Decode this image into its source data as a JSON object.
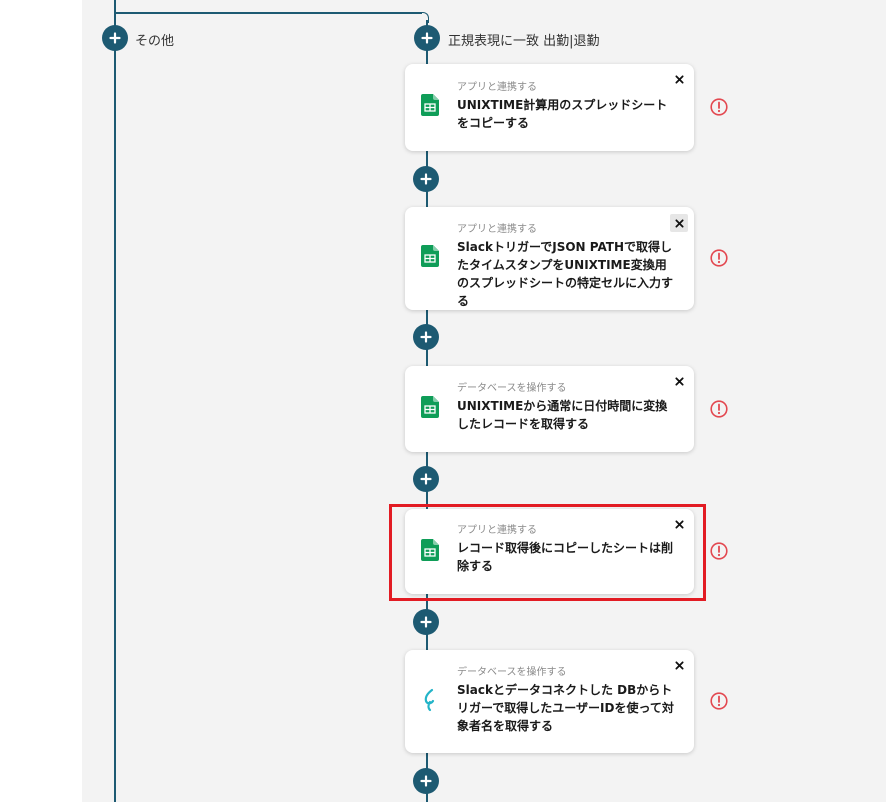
{
  "branches": {
    "other": {
      "label": "その他"
    },
    "regex": {
      "label": "正規表現に一致 出勤|退勤"
    }
  },
  "steps": [
    {
      "subtitle": "アプリと連携する",
      "title": "UNIXTIME計算用のスプレッドシートをコピーする",
      "app_icon": "google-sheets-icon"
    },
    {
      "subtitle": "アプリと連携する",
      "title": "SlackトリガーでJSON PATHで取得したタイムスタンプをUNIXTIME変換用のスプレッドシートの特定セルに入力する",
      "app_icon": "google-sheets-icon"
    },
    {
      "subtitle": "データベースを操作する",
      "title": "UNIXTIMEから通常に日付時間に変換したレコードを取得する",
      "app_icon": "google-sheets-icon"
    },
    {
      "subtitle": "アプリと連携する",
      "title": "レコード取得後にコピーしたシートは削除する",
      "app_icon": "google-sheets-icon",
      "highlighted": true
    },
    {
      "subtitle": "データベースを操作する",
      "title": "Slackとデータコネクトした DBからトリガーで取得したユーザーIDを使って対象者名を取得する",
      "app_icon": "yoom-database-icon"
    }
  ],
  "colors": {
    "connector": "#1d5a72",
    "sheets_green": "#0f9d58",
    "warning_red": "#e34850",
    "highlight_red": "#e21b23",
    "db_icon_teal": "#23b4c8"
  }
}
